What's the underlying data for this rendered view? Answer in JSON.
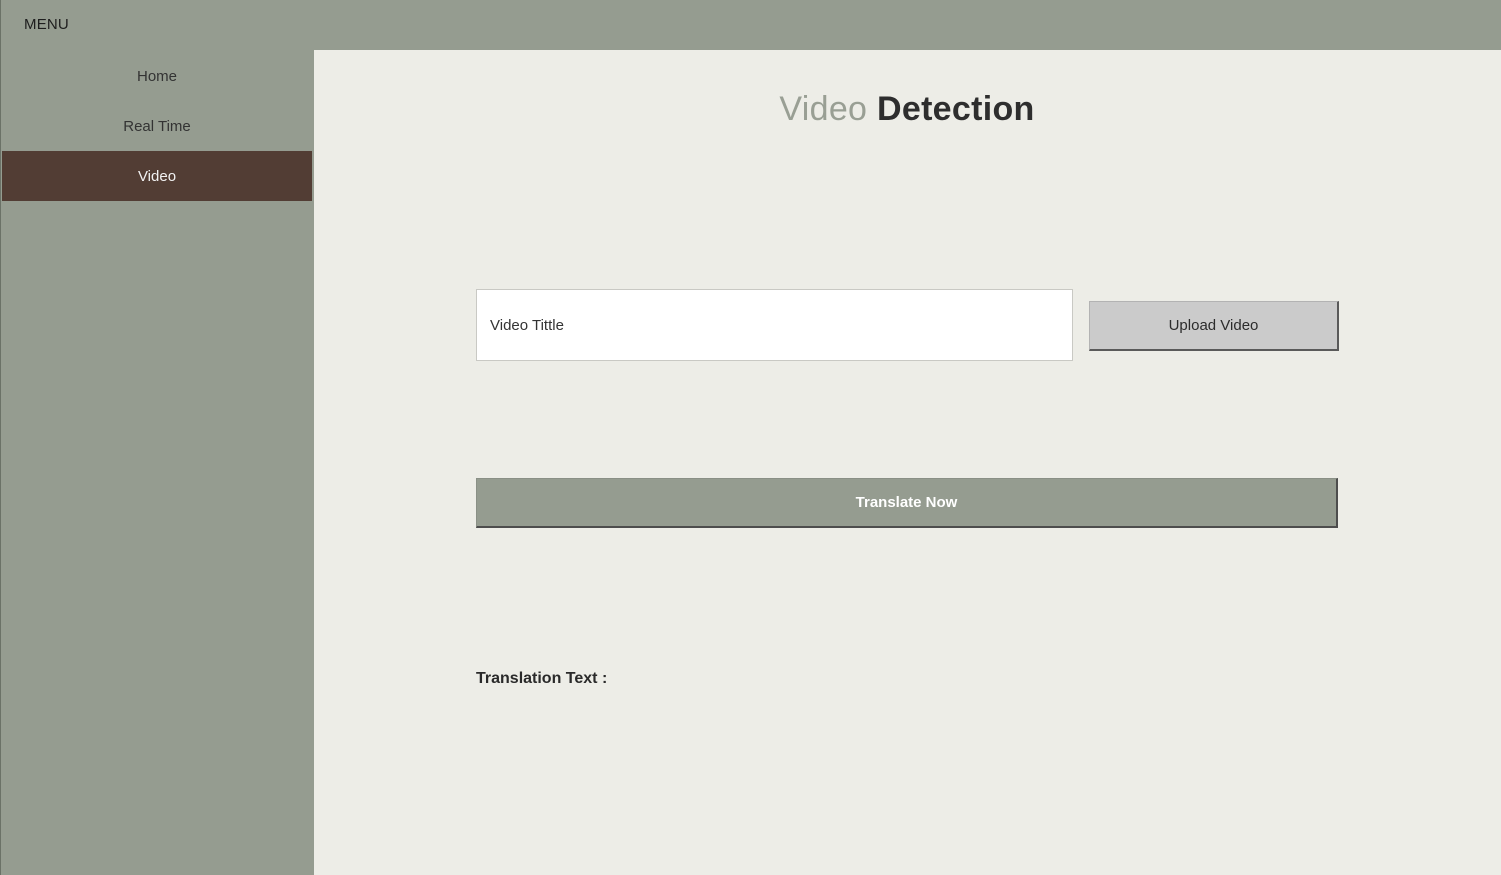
{
  "header": {
    "menu_label": "MENU"
  },
  "sidebar": {
    "items": [
      {
        "label": "Home",
        "active": false
      },
      {
        "label": "Real Time",
        "active": false
      },
      {
        "label": "Video",
        "active": true
      }
    ]
  },
  "main": {
    "title_accent": "Video",
    "title_main": "Detection",
    "video_title_input": {
      "value": "Video Tittle"
    },
    "upload_label": "Upload Video",
    "translate_label": "Translate Now",
    "translation_label": "Translation Text :"
  },
  "colors": {
    "sidebar_bg": "#959c90",
    "active_item_bg": "#523d34",
    "main_bg": "#edede7",
    "title_accent": "#999f94",
    "upload_button_bg": "#cbcbcb",
    "translate_button_bg": "#959c90"
  }
}
